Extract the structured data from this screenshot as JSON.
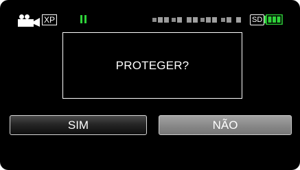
{
  "status_bar": {
    "mode_icon": "video-camera-icon",
    "quality": "XP",
    "playback_icon": "pause-icon",
    "timecode_display": "blurred-timecode",
    "media": "SD",
    "battery_icon": "battery-icon",
    "accent_color": "#2fd33a"
  },
  "dialog": {
    "message": "PROTEGER?"
  },
  "buttons": {
    "yes_label": "SIM",
    "no_label": "NÃO"
  },
  "colors": {
    "background": "#000000",
    "text": "#ffffff",
    "selected_button": "#8a8a8a"
  }
}
